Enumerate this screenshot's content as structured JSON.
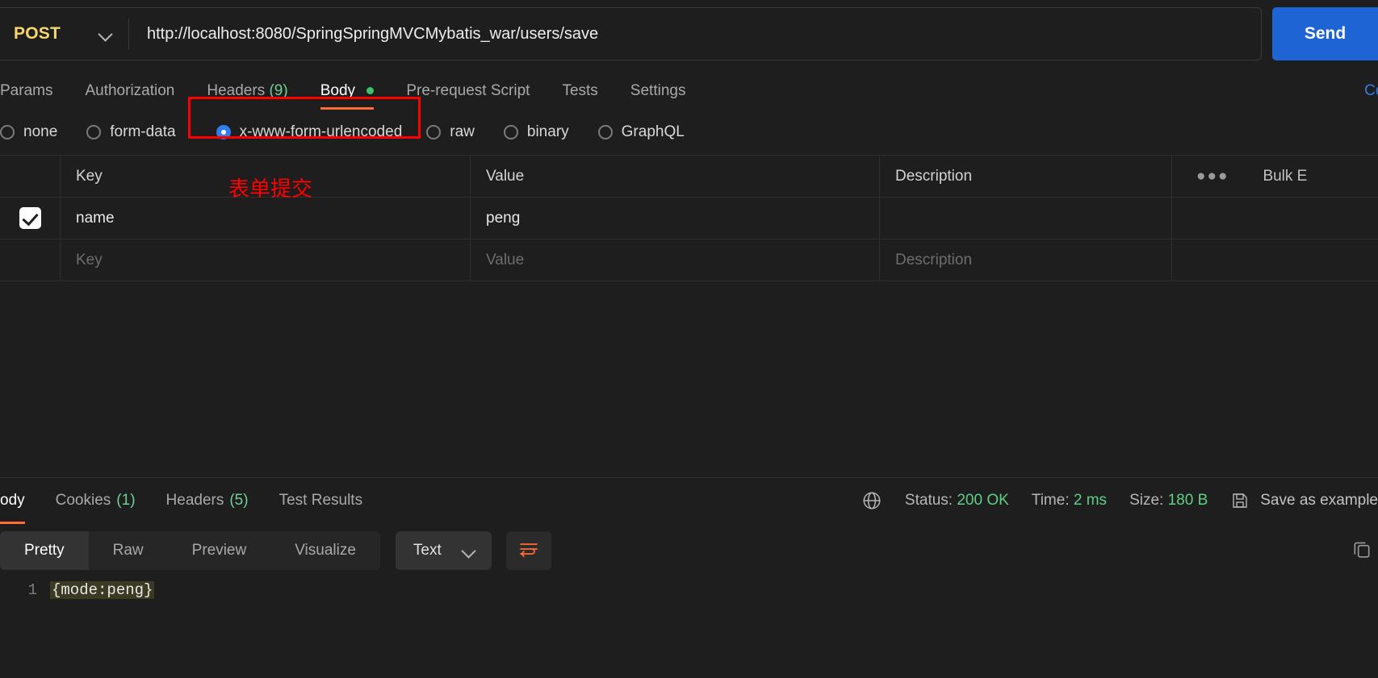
{
  "request": {
    "method": "POST",
    "url": "http://localhost:8080/SpringSpringMVCMybatis_war/users/save",
    "send_label": "Send",
    "chevron_icon": "chevron-down-icon"
  },
  "request_tabs": [
    {
      "label": "Params",
      "active": false
    },
    {
      "label": "Authorization",
      "active": false
    },
    {
      "label": "Headers",
      "count": "(9)",
      "active": false
    },
    {
      "label": "Body",
      "active": true,
      "dot": true
    },
    {
      "label": "Pre-request Script",
      "active": false
    },
    {
      "label": "Tests",
      "active": false
    },
    {
      "label": "Settings",
      "active": false
    }
  ],
  "cookies_link": "Coo",
  "body_types": [
    {
      "label": "none",
      "checked": false
    },
    {
      "label": "form-data",
      "checked": false
    },
    {
      "label": "x-www-form-urlencoded",
      "checked": true
    },
    {
      "label": "raw",
      "checked": false
    },
    {
      "label": "binary",
      "checked": false
    },
    {
      "label": "GraphQL",
      "checked": false
    }
  ],
  "annotations": {
    "highlight_color": "#ff0000",
    "form_submit_note": "表单提交"
  },
  "kv_table": {
    "headers": {
      "key": "Key",
      "value": "Value",
      "description": "Description"
    },
    "bulk_edit_label": "Bulk E",
    "more_icon": "ellipsis-icon",
    "rows": [
      {
        "checked": true,
        "key": "name",
        "value": "peng",
        "description": ""
      }
    ],
    "placeholder_row": {
      "key": "Key",
      "value": "Value",
      "description": "Description"
    }
  },
  "response_tabs": [
    {
      "label": "ody",
      "active": true
    },
    {
      "label": "Cookies",
      "count": "(1)",
      "active": false
    },
    {
      "label": "Headers",
      "count": "(5)",
      "active": false
    },
    {
      "label": "Test Results",
      "active": false
    }
  ],
  "response_meta": {
    "globe_icon": "globe-icon",
    "status_label": "Status:",
    "status_value": "200 OK",
    "time_label": "Time:",
    "time_value": "2 ms",
    "size_label": "Size:",
    "size_value": "180 B",
    "save_icon": "floppy-disk-icon",
    "save_as_example": "Save as example",
    "accent_green": "#5fcf86"
  },
  "view_modes": [
    {
      "label": "Pretty",
      "active": true
    },
    {
      "label": "Raw",
      "active": false
    },
    {
      "label": "Preview",
      "active": false
    },
    {
      "label": "Visualize",
      "active": false
    }
  ],
  "format_dropdown": {
    "label": "Text",
    "chevron_icon": "chevron-down-icon"
  },
  "wrap_icon": "word-wrap-icon",
  "copy_icon": "copy-icon",
  "response_body": {
    "line_number": "1",
    "content": "{mode:peng}"
  }
}
